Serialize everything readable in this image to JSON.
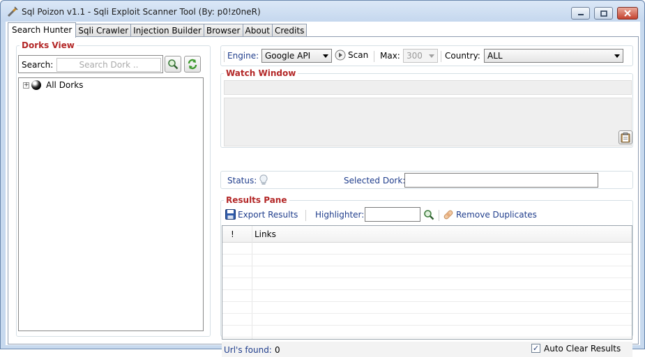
{
  "window": {
    "title": "Sql Poizon v1.1 - Sqli Exploit Scanner Tool (By: p0!z0neR)"
  },
  "tabs": [
    {
      "label": "Search Hunter",
      "active": true
    },
    {
      "label": "Sqli Crawler",
      "active": false
    },
    {
      "label": "Injection Builder",
      "active": false
    },
    {
      "label": "Browser",
      "active": false
    },
    {
      "label": "About",
      "active": false
    },
    {
      "label": "Credits",
      "active": false
    }
  ],
  "dorks_view": {
    "title": "Dorks View",
    "search_label": "Search:",
    "search_placeholder": "Search Dork ..",
    "tree_root": "All Dorks"
  },
  "scan_bar": {
    "engine_label": "Engine:",
    "engine_value": "Google API",
    "scan_label": "Scan",
    "max_label": "Max:",
    "max_value": "300",
    "country_label": "Country:",
    "country_value": "ALL"
  },
  "watch_window": {
    "title": "Watch Window"
  },
  "status_bar": {
    "status_label": "Status:",
    "selected_dork_label": "Selected Dork:",
    "selected_dork_value": ""
  },
  "results_pane": {
    "title": "Results Pane",
    "export_label": "Export Results",
    "highlighter_label": "Highlighter:",
    "highlighter_value": "",
    "remove_duplicates_label": "Remove Duplicates",
    "columns": [
      "!",
      "Links"
    ],
    "urls_found_label": "Url's found:",
    "urls_found_value": "0",
    "auto_clear_label": "Auto Clear Results",
    "auto_clear_checked": true
  }
}
